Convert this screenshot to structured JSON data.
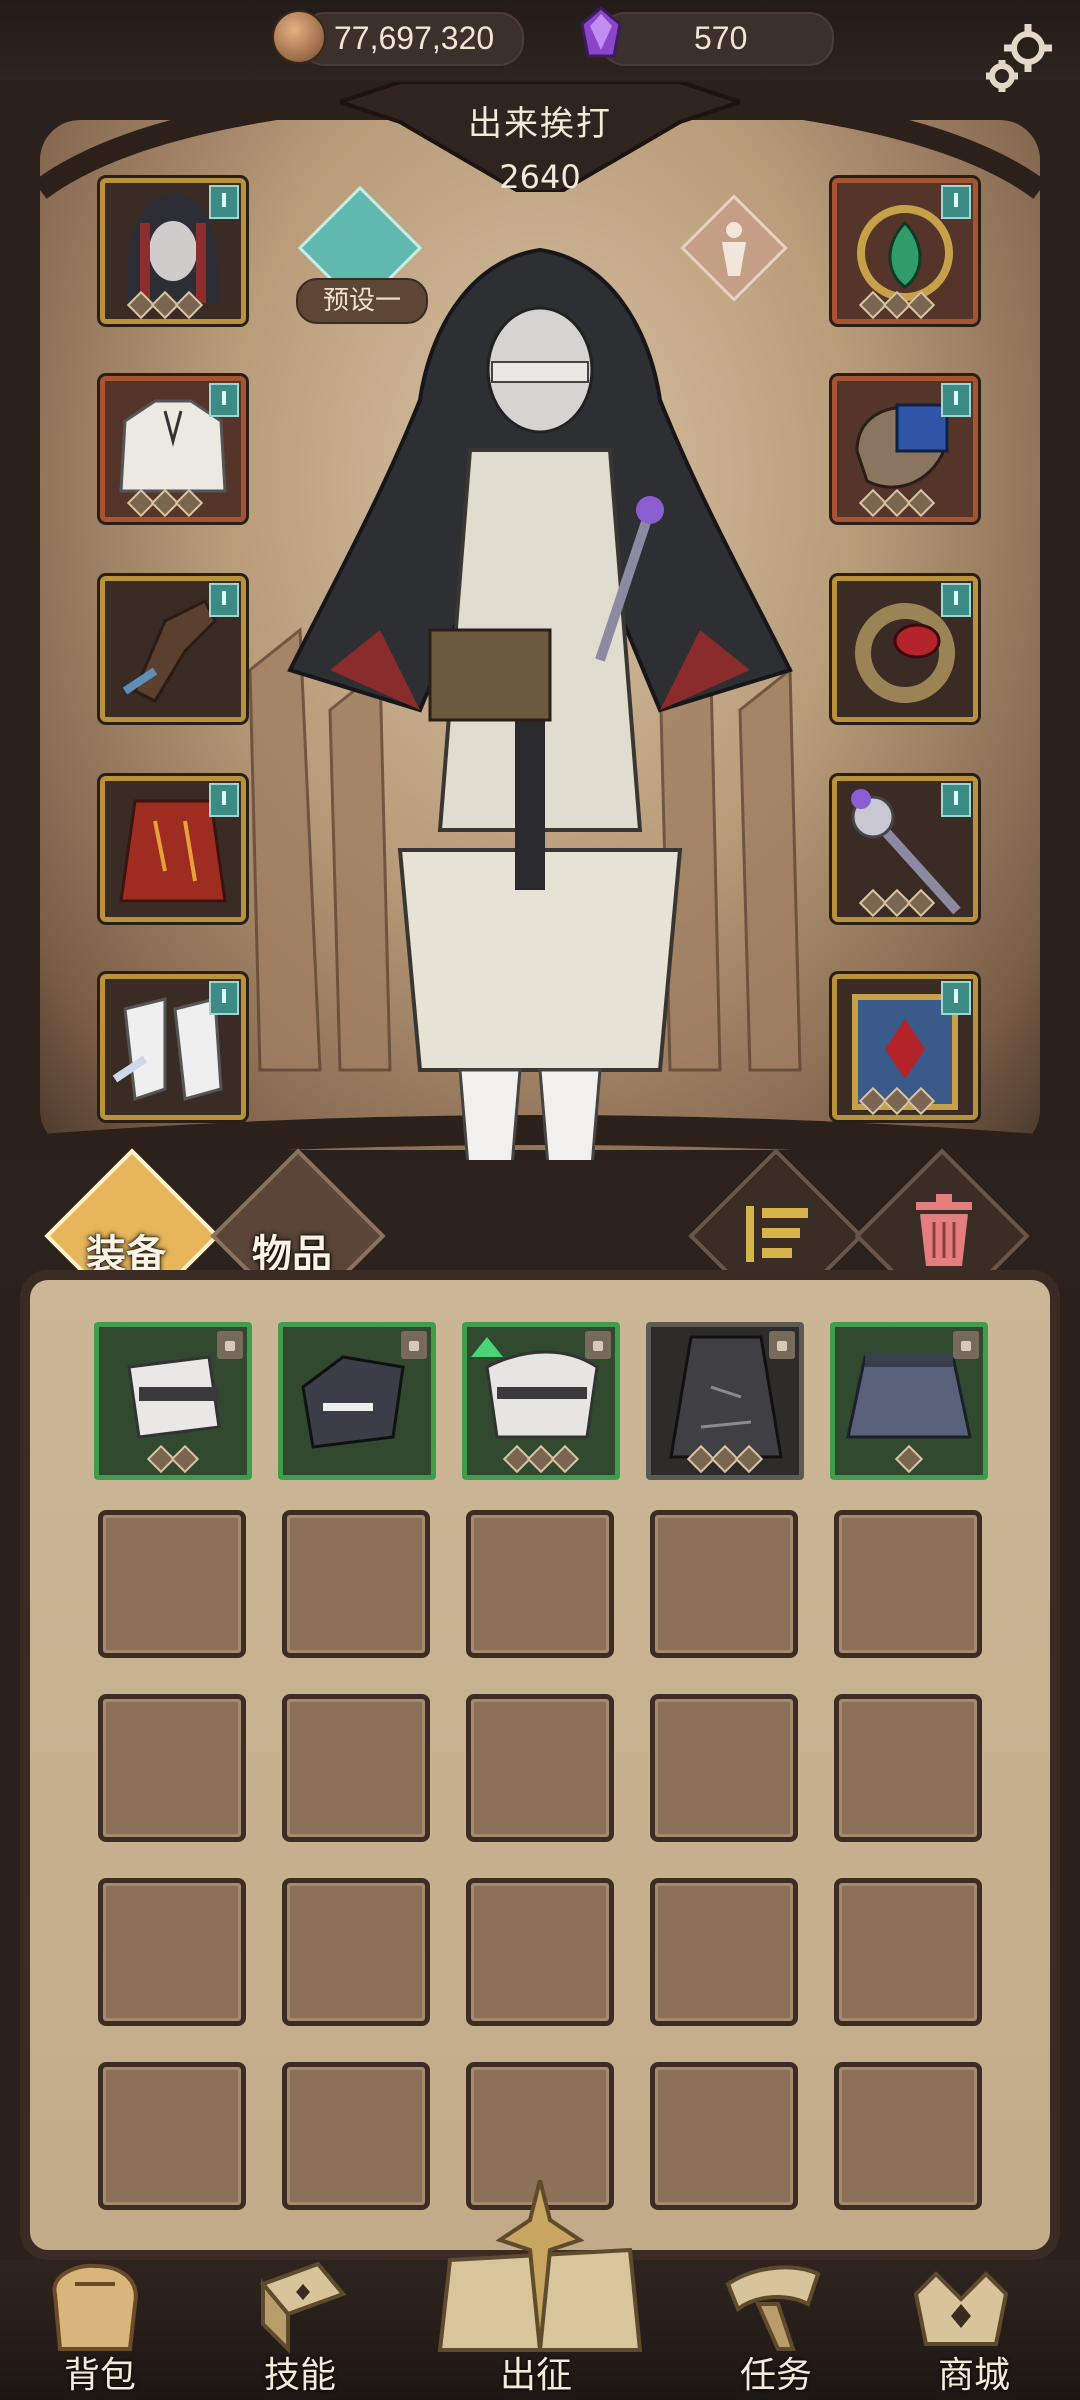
{
  "currency": {
    "coins": "77,697,320",
    "gems": "570"
  },
  "header": {
    "title": "出来挨打",
    "power": "2640"
  },
  "preset": {
    "label": "预设一"
  },
  "tabs": [
    {
      "label": "装备"
    },
    {
      "label": "物品"
    }
  ],
  "nav": [
    {
      "label": "背包"
    },
    {
      "label": "技能"
    },
    {
      "label": "出征"
    },
    {
      "label": "任务"
    },
    {
      "label": "商城"
    }
  ],
  "equipment_slots": {
    "left": [
      "hood",
      "blouse",
      "gloves",
      "skirt",
      "boots"
    ],
    "right": [
      "amulet",
      "bracer",
      "ring",
      "mace",
      "tome"
    ]
  },
  "inventory": {
    "items": [
      "boot-item",
      "glove-item",
      "collar-item",
      "robe-item",
      "skirt-item"
    ],
    "empty_rows": 4,
    "columns": 5
  },
  "colors": {
    "accent": "#5fb7ad",
    "common_frame": "#b8933b",
    "rare_frame": "#a55532",
    "uncommon_frame": "#3f9d4b"
  }
}
